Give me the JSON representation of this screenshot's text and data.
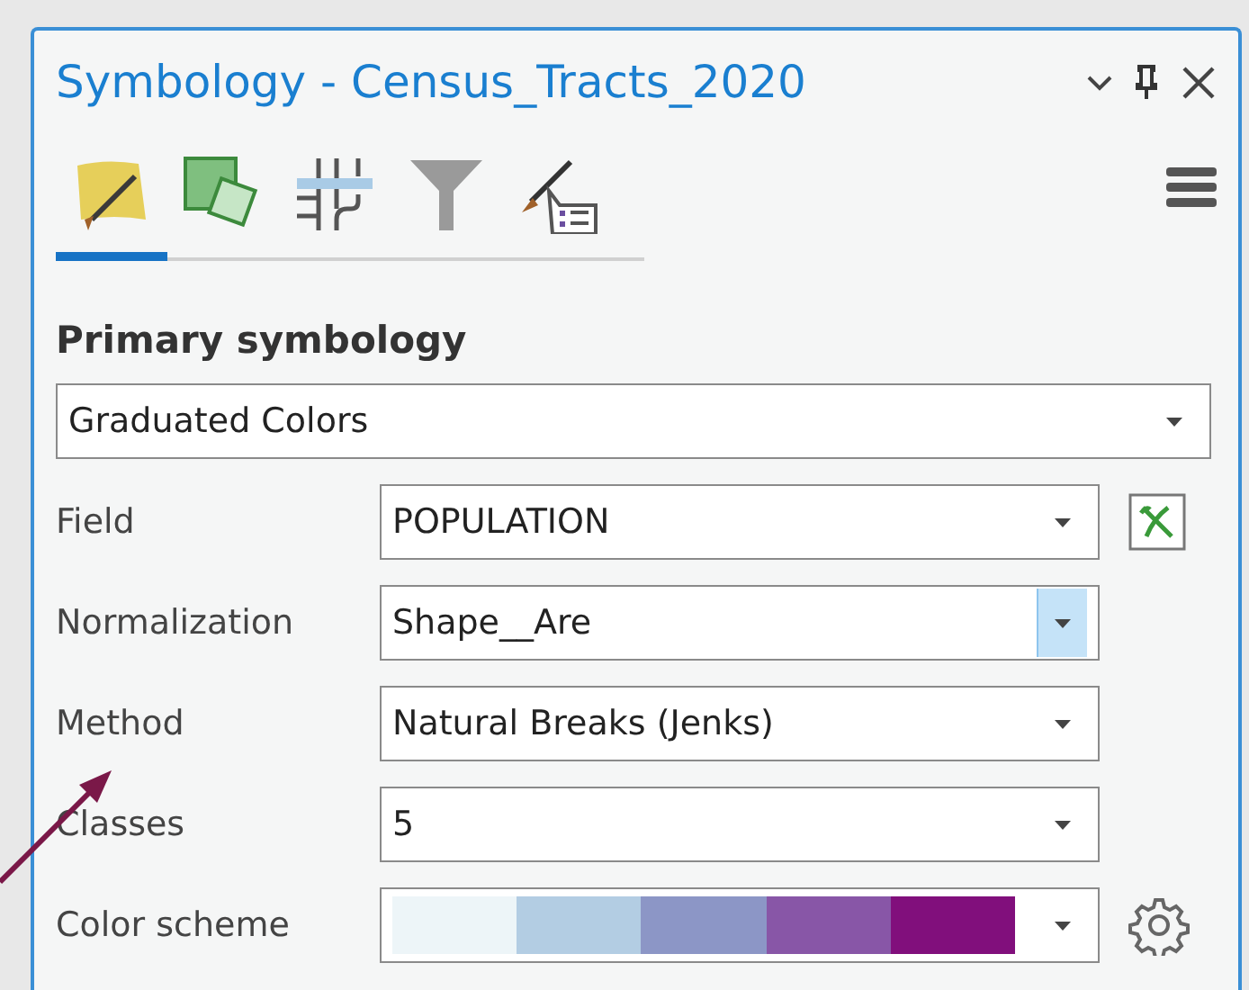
{
  "window": {
    "title": "Symbology - Census_Tracts_2020"
  },
  "tabs": [
    {
      "kind": "primary",
      "selected": true
    },
    {
      "kind": "vary",
      "selected": false
    },
    {
      "kind": "labels",
      "selected": false
    },
    {
      "kind": "filter",
      "selected": false
    },
    {
      "kind": "legend",
      "selected": false
    }
  ],
  "section": {
    "heading": "Primary symbology",
    "renderer": "Graduated Colors"
  },
  "rows": [
    {
      "label": "Field",
      "kind": "dropdown",
      "value": "POPULATION",
      "side": {
        "kind": "expression"
      },
      "hovered": false
    },
    {
      "label": "Normalization",
      "kind": "dropdown",
      "value": "Shape__Are",
      "hovered": true
    },
    {
      "label": "Method",
      "kind": "dropdown",
      "value": "Natural Breaks (Jenks)",
      "hovered": false
    },
    {
      "label": "Classes",
      "kind": "dropdown",
      "value": "5",
      "hovered": false
    },
    {
      "label": "Color scheme",
      "kind": "ramp",
      "colors": [
        {
          "color": "#edf5f8"
        },
        {
          "color": "#b3cde3"
        },
        {
          "color": "#8c96c6"
        },
        {
          "color": "#8856a7"
        },
        {
          "color": "#810f7c"
        }
      ],
      "side": {
        "kind": "settings"
      },
      "hovered": false
    }
  ]
}
